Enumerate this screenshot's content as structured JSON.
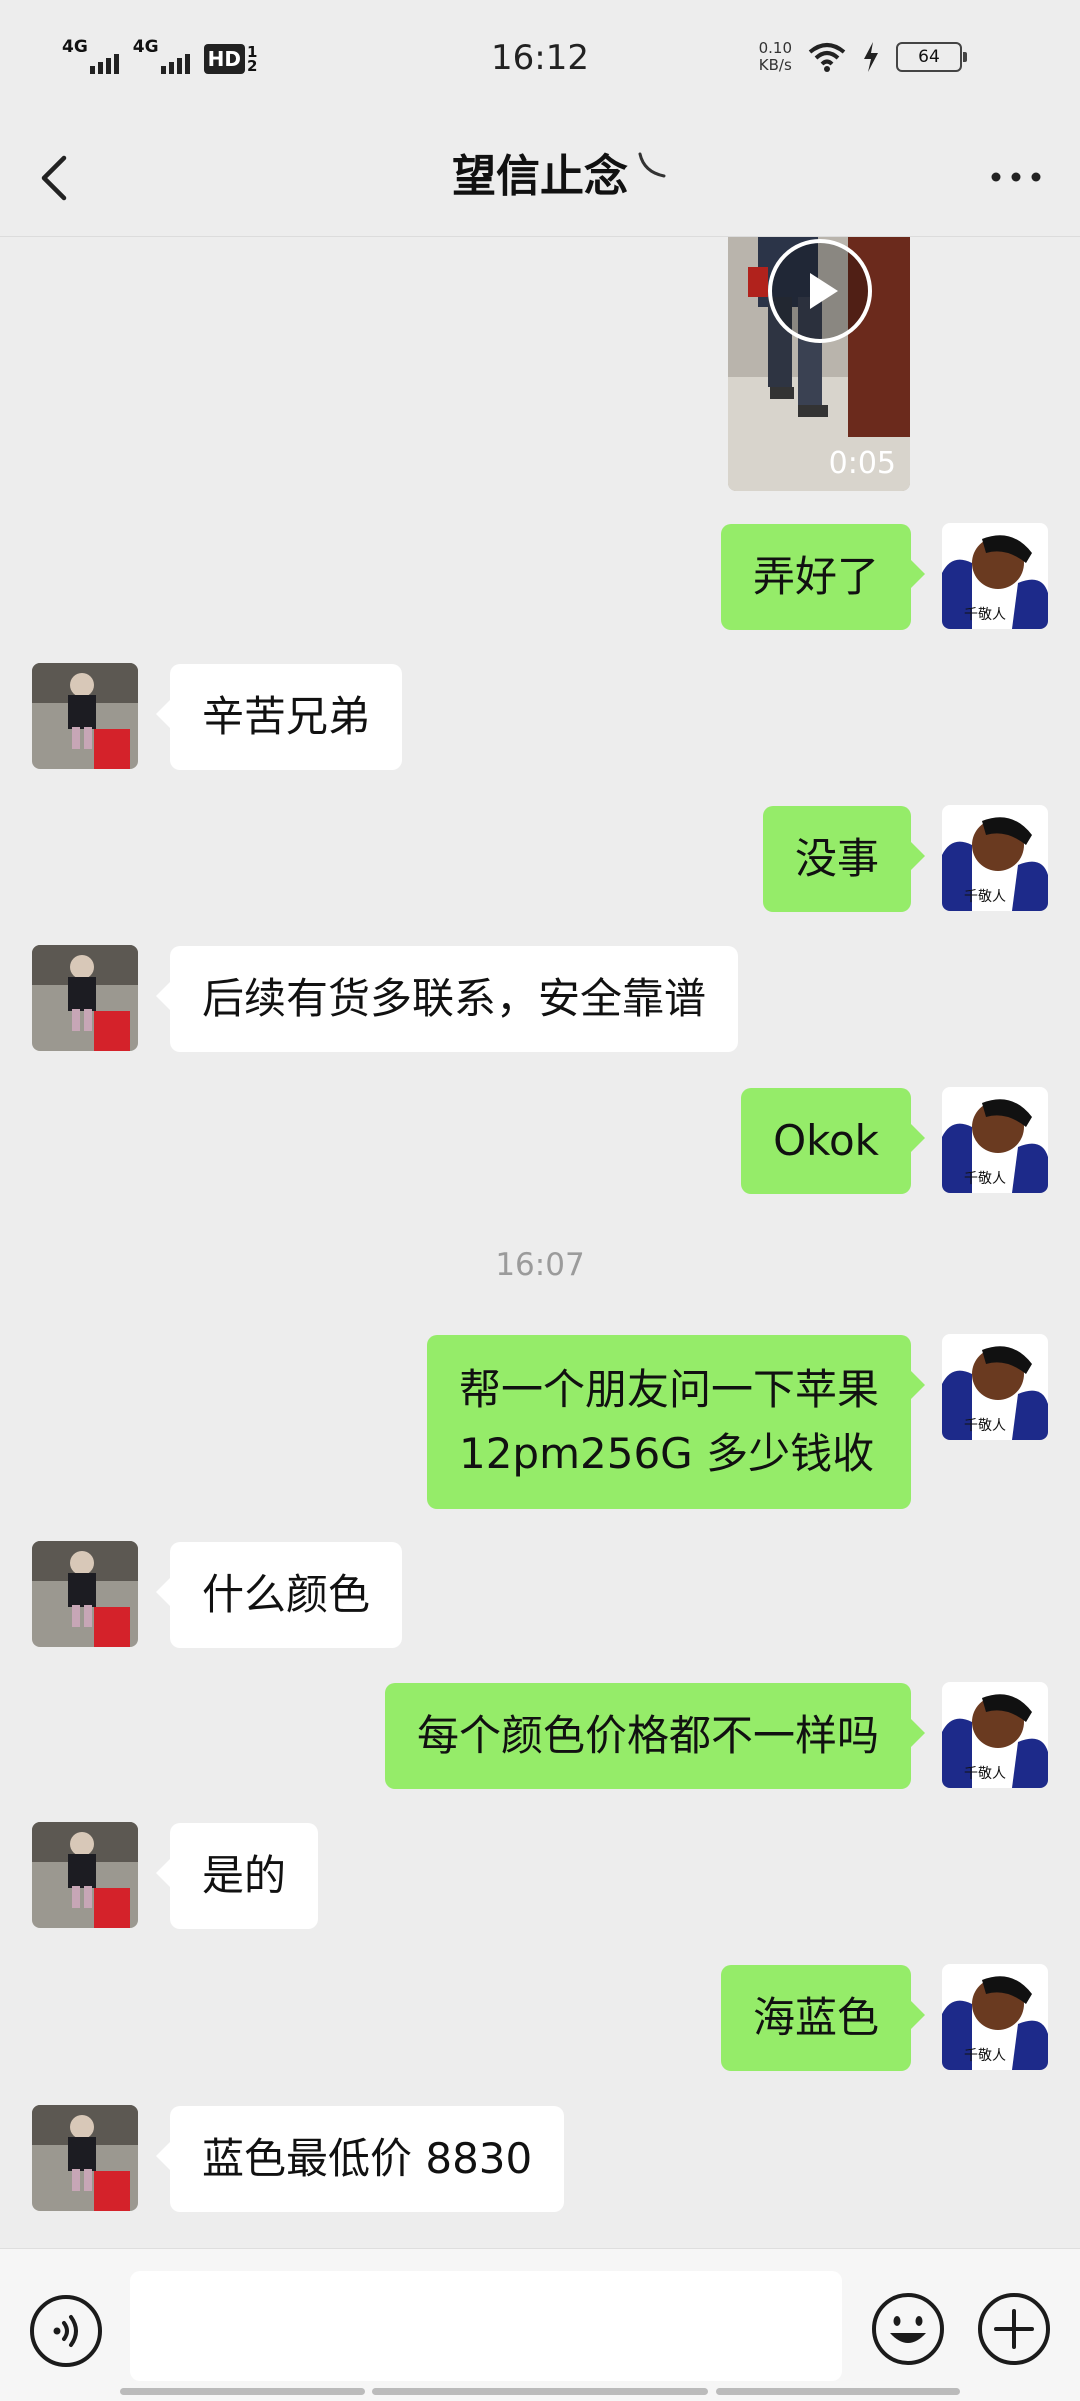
{
  "status_bar": {
    "time": "16:12",
    "sim1": "4G",
    "sim2": "4G",
    "hd": "HD",
    "hd_sub": "1\n2",
    "speed_value": "0.10",
    "speed_unit": "KB/s",
    "battery": "64"
  },
  "header": {
    "title": "望信止念"
  },
  "messages": [
    {
      "from": "me",
      "text": "弄好了"
    },
    {
      "from": "other",
      "text": "辛苦兄弟"
    },
    {
      "from": "me",
      "text": "没事"
    },
    {
      "from": "other",
      "text": "后续有货多联系，安全靠谱"
    },
    {
      "from": "me",
      "text": "Okok"
    },
    {
      "from": "time",
      "text": "16:07"
    },
    {
      "from": "me",
      "text": "帮一个朋友问一下苹果\n12pm256G 多少钱收"
    },
    {
      "from": "other",
      "text": "什么颜色"
    },
    {
      "from": "me",
      "text": "每个颜色价格都不一样吗"
    },
    {
      "from": "other",
      "text": "是的"
    },
    {
      "from": "me",
      "text": "海蓝色"
    },
    {
      "from": "other",
      "text": "蓝色最低价 8830"
    }
  ],
  "video": {
    "duration": "0:05"
  },
  "input": {
    "value": ""
  },
  "icons": {
    "back": "back-arrow-icon",
    "more": "more-dots-icon",
    "voice": "voice-icon",
    "emoji": "emoji-icon",
    "plus": "plus-icon",
    "play": "play-icon"
  },
  "colors": {
    "my_bubble": "#95ec69",
    "other_bubble": "#ffffff",
    "background": "#ededed"
  }
}
